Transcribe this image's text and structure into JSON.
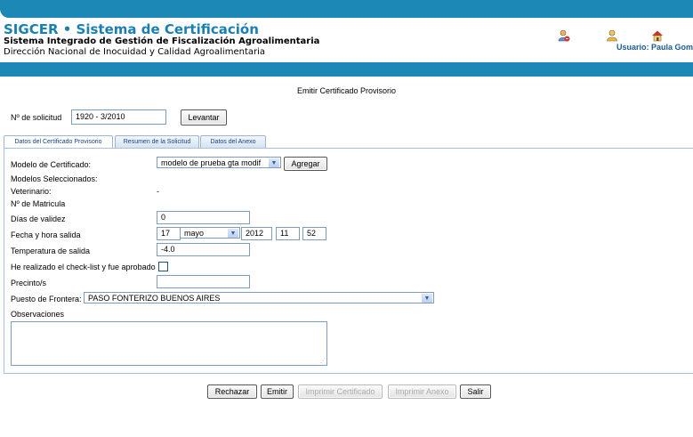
{
  "header": {
    "app_title": "SIGCER • Sistema de Certificación",
    "subtitle": "Sistema Integrado de Gestión de Fiscalización Agroalimentaria",
    "org": "Dirección Nacional de Inocuidad y Calidad Agroalimentaria",
    "user_label": "Usuario: Paula Gomez"
  },
  "page_title": "Emitir Certificado Provisorio",
  "solicitud": {
    "label": "Nº de solicitud",
    "value": "1920 - 3/2010",
    "button": "Levantar"
  },
  "tabs": [
    {
      "label": "Datos del Certificado Provisorio",
      "active": true
    },
    {
      "label": "Resumen de la Solicitud",
      "active": false
    },
    {
      "label": "Datos del Anexo",
      "active": false
    }
  ],
  "form": {
    "modelo_label": "Modelo de Certificado:",
    "modelo_value": "modelo de prueba gta modif",
    "agregar": "Agregar",
    "modelos_sel_label": "Modelos Seleccionados:",
    "veterinario_label": "Veterinario:",
    "veterinario_value": "-",
    "matricula_label": "Nº de Matricula",
    "dias_label": "Días de validez",
    "dias_value": "0",
    "fecha_label": "Fecha y hora salida",
    "fecha_dia": "17",
    "fecha_mes": "mayo",
    "fecha_anio": "2012",
    "fecha_hora": "11",
    "fecha_min": "52",
    "temp_label": "Temperatura de salida",
    "temp_value": "-4.0",
    "checklist_label": "He realizado el check-list y fue aprobado",
    "precinto_label": "Precinto/s",
    "precinto_value": "",
    "puesto_label": "Puesto de Frontera:",
    "puesto_value": "PASO FONTERIZO BUENOS AIRES",
    "obs_label": "Observaciones",
    "obs_value": ""
  },
  "actions": {
    "rechazar": "Rechazar",
    "emitir": "Emitir",
    "imprimir_cert": "Imprimir Certificado",
    "imprimir_anexo": "Imprimir Anexo",
    "salir": "Salir"
  },
  "colors": {
    "brand": "#1b88b6",
    "title_blue": "#1b7fb0"
  },
  "icons": [
    "user-delete-icon",
    "user-icon",
    "home-icon"
  ]
}
